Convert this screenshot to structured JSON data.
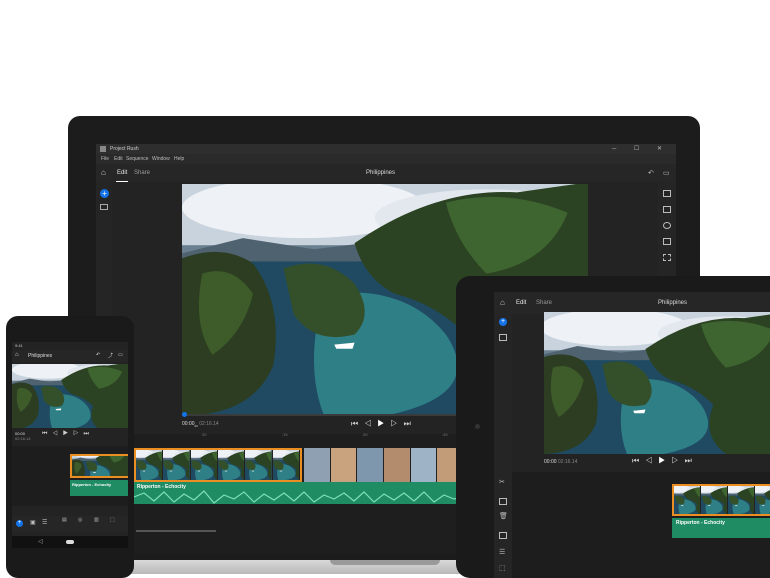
{
  "laptop": {
    "window_title": "Project Rush",
    "menu": [
      "File",
      "Edit",
      "Sequence",
      "Window",
      "Help"
    ],
    "tabs": [
      "Edit",
      "Share"
    ],
    "project_title": "Philippines",
    "timecode_current": "00:00",
    "timecode_frames": "00",
    "timecode_duration": "02:16.14",
    "ruler_ticks": [
      "00",
      ":15",
      ":30",
      ":45",
      "1:00"
    ],
    "audio_label": "Ripperton - Echocity",
    "win_buttons": "─ ☐ ✕"
  },
  "phone": {
    "status_time": "9:41",
    "project_title": "Philippines",
    "timecode_current": "00:00",
    "timecode_duration": "02:16.14",
    "audio_label": "Ripperton - Echocity",
    "tool_labels": [
      "",
      "Titles",
      "Transitions",
      "Color",
      "Audio",
      "Transform"
    ]
  },
  "tablet": {
    "tabs": [
      "Edit",
      "Share"
    ],
    "project_title": "Philippines",
    "timecode_current": "00:00",
    "timecode_duration": "02:16.14",
    "audio_label": "Ripperton - Echocity"
  },
  "colors": {
    "accent": "#1473e6",
    "clip_outline": "#ea8e22",
    "audio_track": "#1f8c63",
    "panel_bg": "#232323"
  }
}
